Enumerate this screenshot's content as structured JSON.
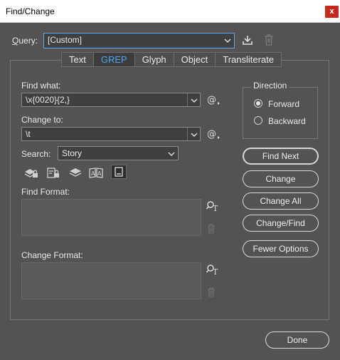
{
  "window": {
    "title": "Find/Change",
    "close_glyph": "x"
  },
  "query": {
    "label": "Query:",
    "value": "[Custom]"
  },
  "tabs": [
    {
      "label": "Text",
      "active": false
    },
    {
      "label": "GREP",
      "active": true
    },
    {
      "label": "Glyph",
      "active": false
    },
    {
      "label": "Object",
      "active": false
    },
    {
      "label": "Transliterate",
      "active": false
    }
  ],
  "find_what": {
    "label": "Find what:",
    "value": "\\x{0020}{2,}"
  },
  "change_to": {
    "label": "Change to:",
    "value": "\\t"
  },
  "search": {
    "label": "Search:",
    "value": "Story"
  },
  "find_format": {
    "label": "Find Format:"
  },
  "change_format": {
    "label": "Change Format:"
  },
  "direction": {
    "label": "Direction",
    "options": [
      {
        "label": "Forward",
        "selected": true
      },
      {
        "label": "Backward",
        "selected": false
      }
    ]
  },
  "buttons": {
    "find_next": "Find Next",
    "change": "Change",
    "change_all": "Change All",
    "change_find": "Change/Find",
    "fewer_options": "Fewer Options",
    "done": "Done"
  },
  "icons": {
    "save_query": "save-query-icon",
    "delete_query": "trash-icon",
    "special_chars": "at-sign-icon",
    "search_options": [
      "locked-layers-icon",
      "locked-stories-icon",
      "hidden-layers-icon",
      "master-pages-icon",
      "footnotes-icon"
    ]
  },
  "colors": {
    "accent": "#4fa3f2",
    "background": "#535353",
    "field": "#404040",
    "close": "#c42b1c"
  }
}
